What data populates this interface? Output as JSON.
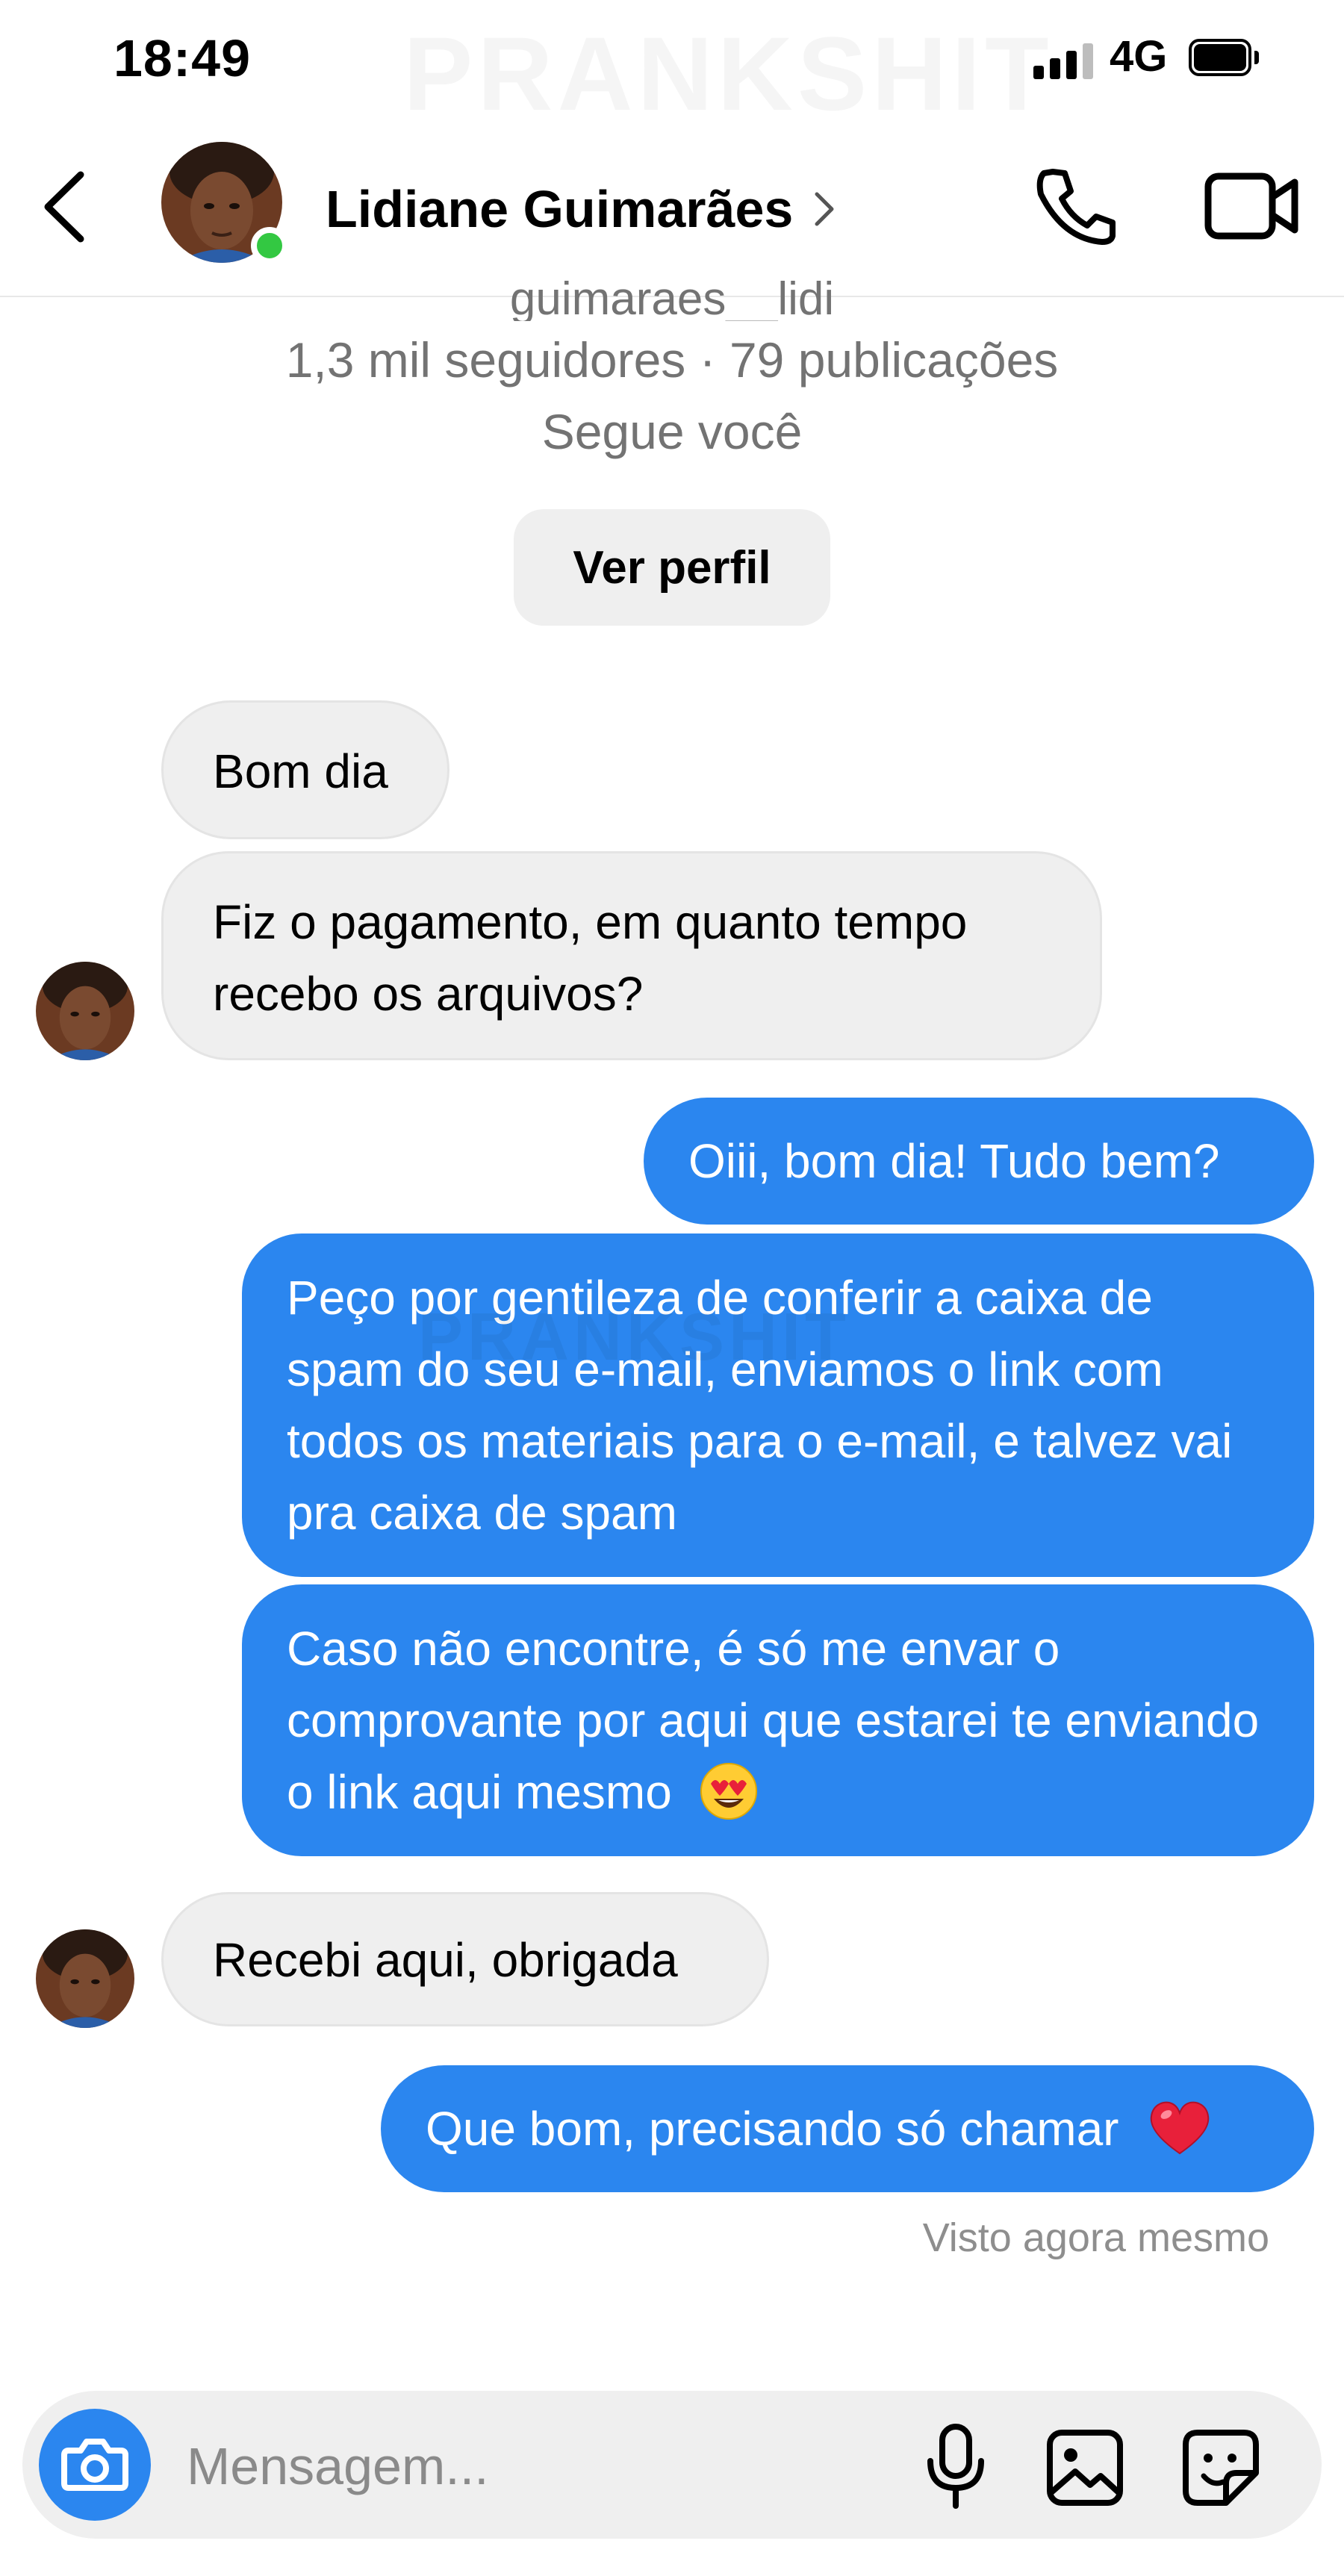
{
  "status_bar": {
    "time": "18:49",
    "network": "4G"
  },
  "watermark": "PRANKSHIT",
  "header": {
    "contact_name": "Lidiane Guimarães",
    "online": true
  },
  "profile": {
    "handle": "guimaraes__lidi",
    "stats": "1,3 mil seguidores · 79 publicações",
    "follows_you": "Segue você",
    "view_profile_label": "Ver perfil"
  },
  "messages": [
    {
      "sender": "contact",
      "text": "Bom dia"
    },
    {
      "sender": "contact",
      "text": "Fiz o pagamento, em quanto tempo recebo os arquivos?"
    },
    {
      "sender": "me",
      "text": "Oiii, bom dia! Tudo bem?"
    },
    {
      "sender": "me",
      "text": "Peço por gentileza de conferir a caixa de spam do seu e-mail, enviamos o link com todos os materiais para o e-mail, e talvez vai pra caixa de spam"
    },
    {
      "sender": "me",
      "text": "Caso não encontre, é só me envar o comprovante por aqui que estarei te enviando o link aqui mesmo",
      "emoji": "heart-eyes-emoji"
    },
    {
      "sender": "contact",
      "text": "Recebi aqui, obrigada"
    },
    {
      "sender": "me",
      "text": "Que bom, precisando só chamar",
      "emoji": "red-heart-emoji"
    }
  ],
  "seen_status": "Visto agora mesmo",
  "composer": {
    "placeholder": "Mensagem..."
  },
  "colors": {
    "outgoing_bubble": "#2b86ef",
    "incoming_bubble": "#efefef",
    "online_dot": "#33c842",
    "secondary_text": "#737373"
  },
  "icons": [
    "back-arrow-icon",
    "chevron-right-icon",
    "phone-icon",
    "video-camera-icon",
    "camera-icon",
    "microphone-icon",
    "image-gallery-icon",
    "sticker-icon"
  ]
}
